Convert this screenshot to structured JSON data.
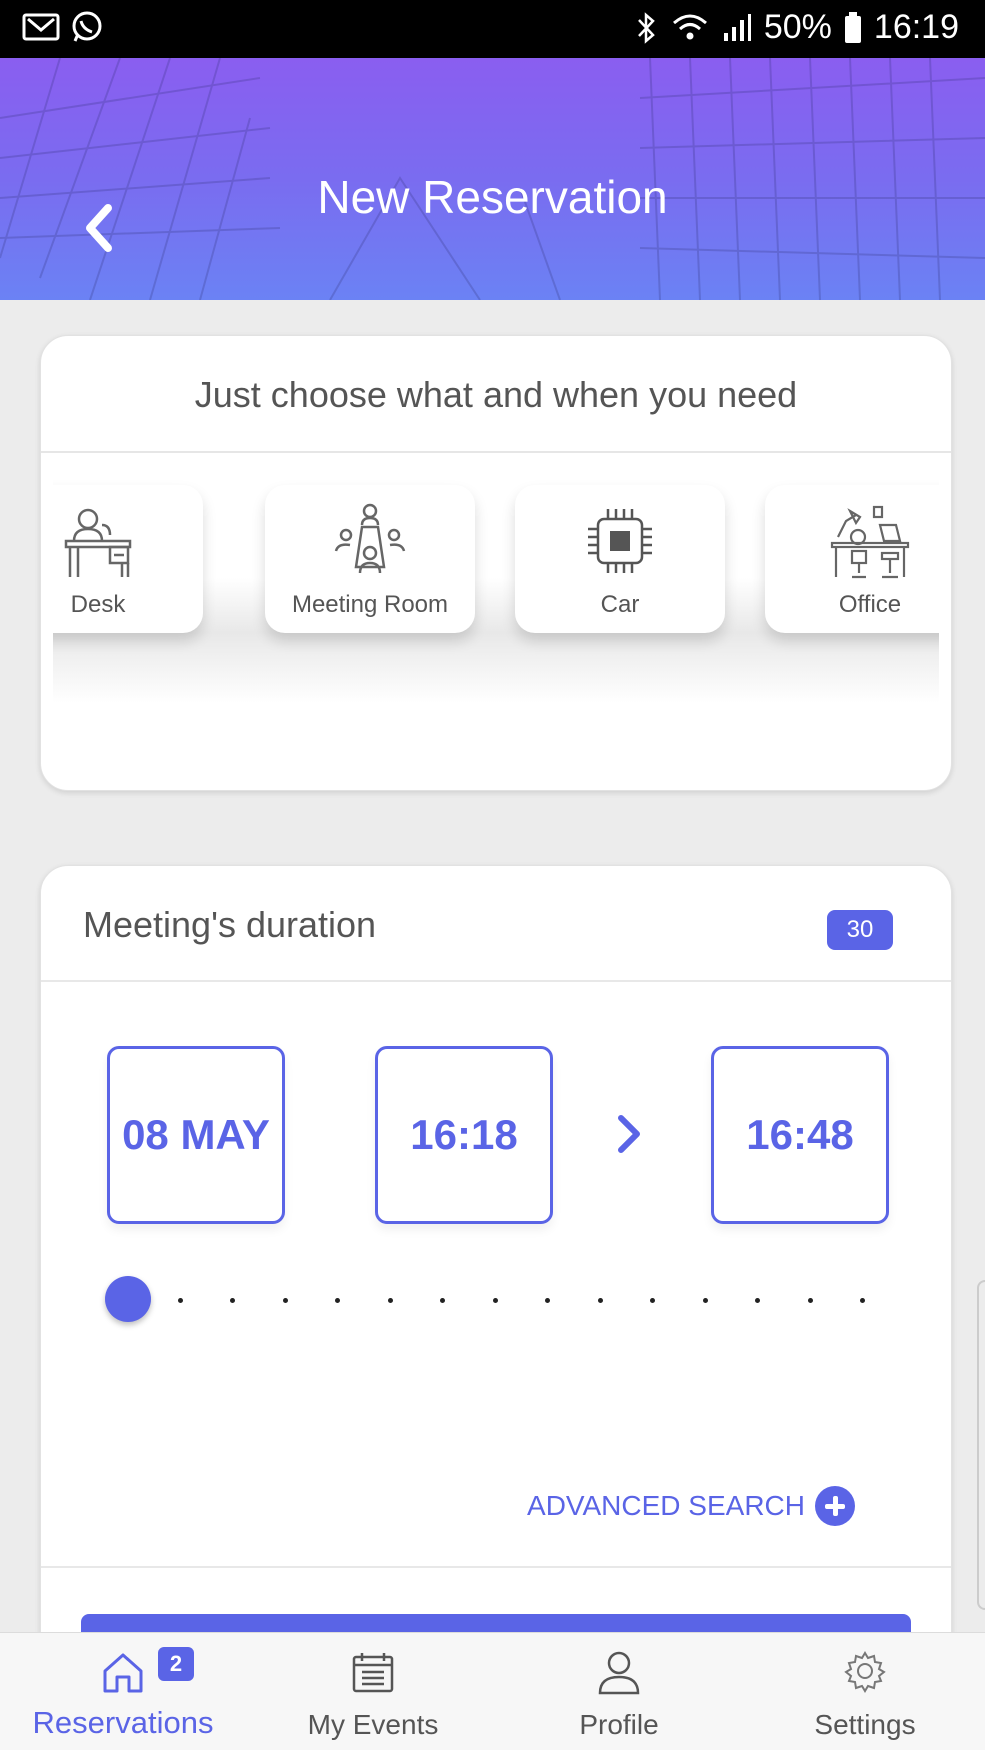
{
  "status_bar": {
    "battery": "50%",
    "time": "16:19",
    "left_icons": [
      "gmail-icon",
      "whatsapp-icon"
    ],
    "right_icons": [
      "bluetooth-icon",
      "wifi-icon",
      "signal-icon",
      "battery-icon"
    ]
  },
  "header": {
    "title": "New Reservation",
    "back_icon": "chevron-left-icon",
    "gradient": [
      "#8a5ef0",
      "#6b82f4"
    ]
  },
  "chooser": {
    "heading": "Just choose what and when you need",
    "items": [
      {
        "label": "Desk",
        "icon": "desk-icon"
      },
      {
        "label": "Meeting Room",
        "icon": "meeting-room-icon"
      },
      {
        "label": "Car",
        "icon": "chip-icon"
      },
      {
        "label": "Office",
        "icon": "office-icon"
      }
    ]
  },
  "duration": {
    "title": "Meeting's duration",
    "badge": "30",
    "date": "08 MAY",
    "start": "16:18",
    "end": "16:48",
    "slider_level": 0,
    "slider_steps": 15,
    "advanced_search": "ADVANCED SEARCH"
  },
  "bottom_nav": {
    "items": [
      {
        "label": "Reservations",
        "icon": "home-icon",
        "badge": "2",
        "active": true
      },
      {
        "label": "My Events",
        "icon": "calendar-icon"
      },
      {
        "label": "Profile",
        "icon": "user-icon"
      },
      {
        "label": "Settings",
        "icon": "gear-icon"
      }
    ]
  },
  "colors": {
    "accent": "#5a64e6",
    "background": "#ececec"
  }
}
